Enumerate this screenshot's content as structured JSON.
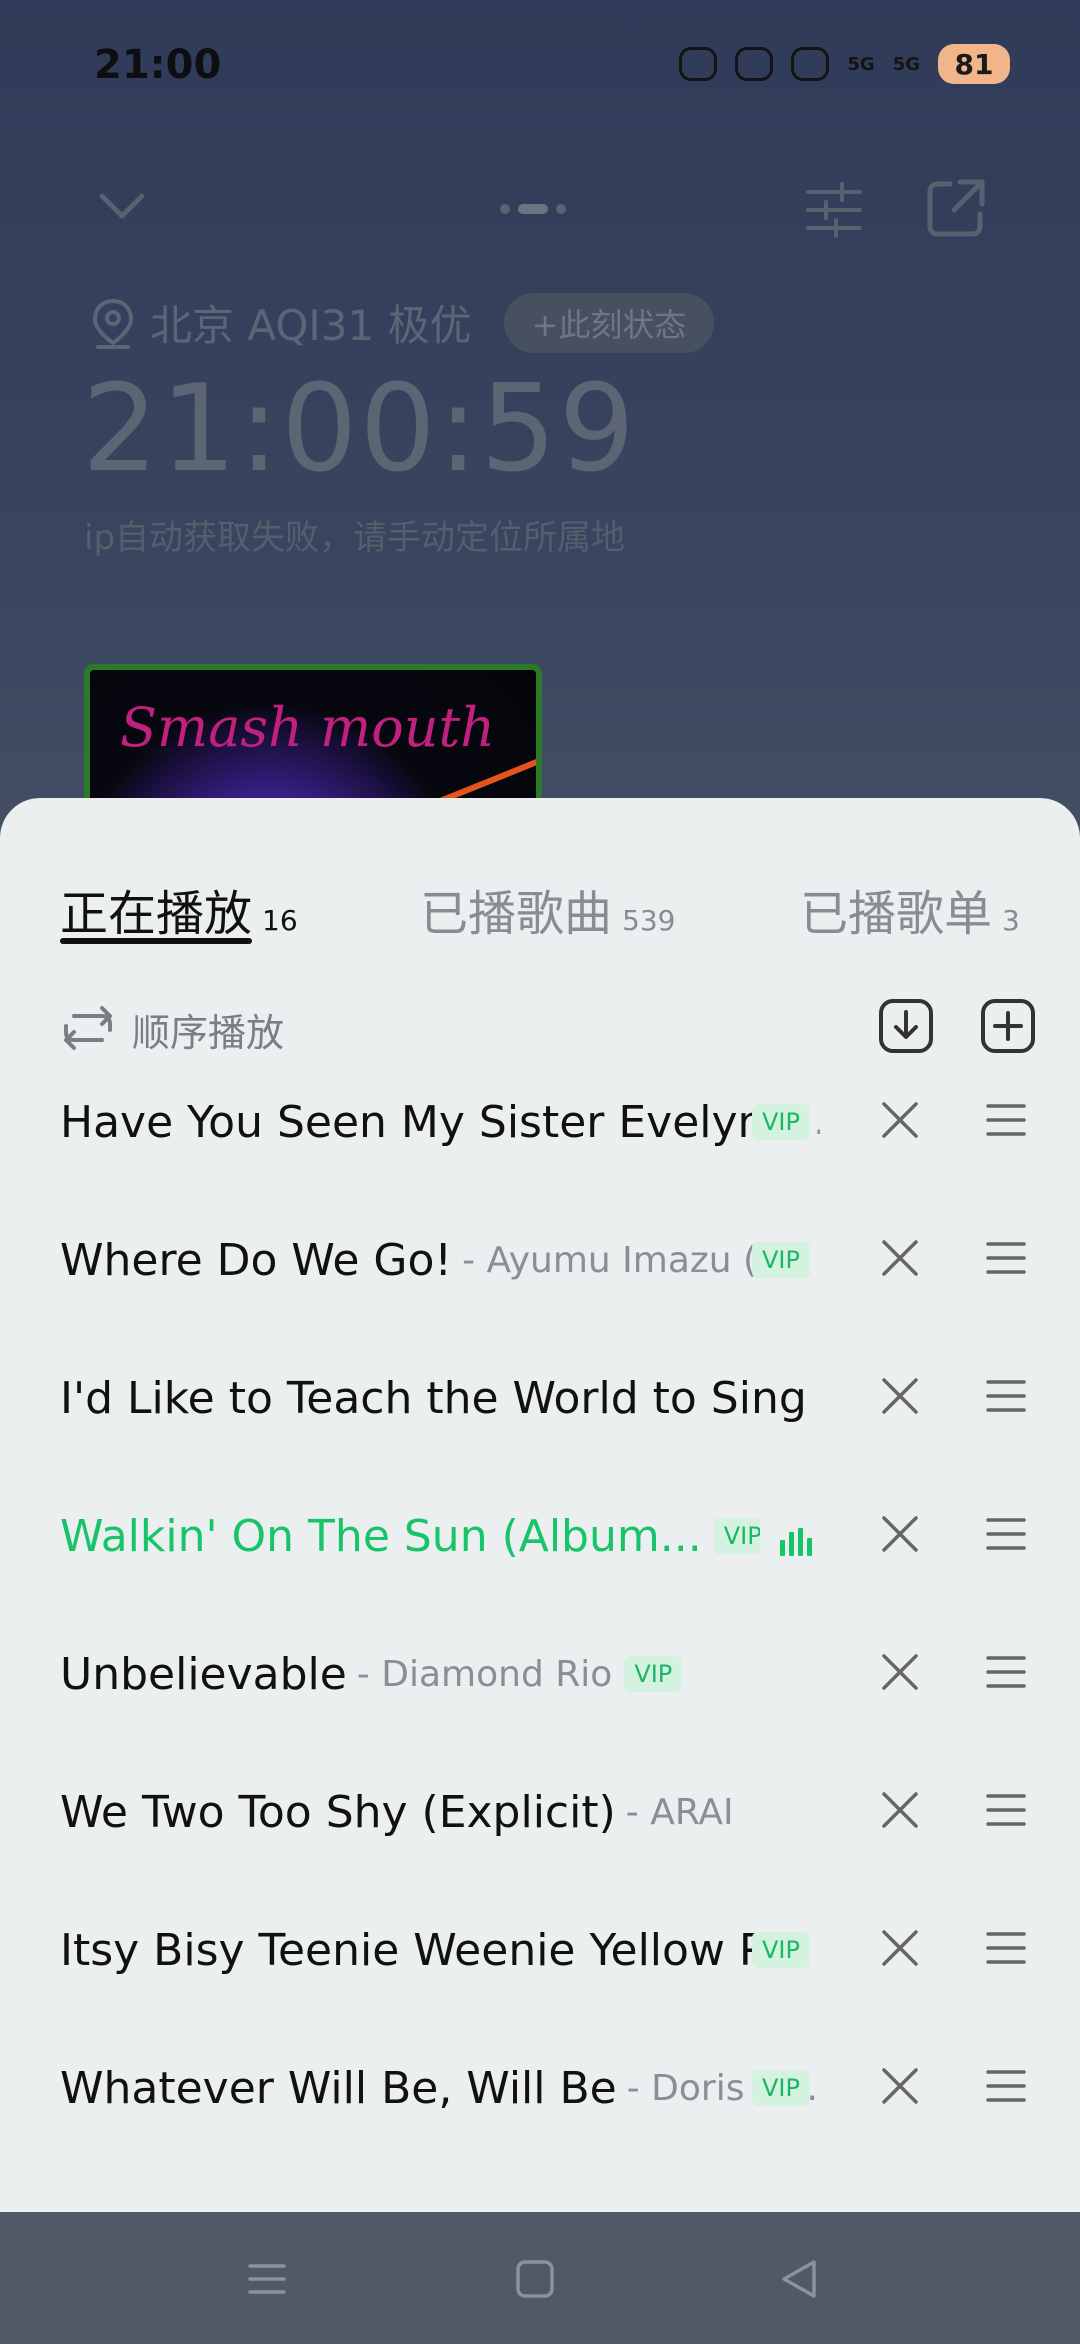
{
  "status_bar": {
    "time": "21:00",
    "network_1": "5G",
    "network_2": "5G",
    "battery": "81"
  },
  "header": {
    "page_dots": 3,
    "active_dot": 1
  },
  "info": {
    "location": "北京 AQI31 极优",
    "status_button": "+此刻状态",
    "clock": "21:00:59",
    "ip_note": "ip自动获取失败，请手动定位所属地"
  },
  "album": {
    "art_text": "Smash mouth"
  },
  "sheet": {
    "tabs": [
      {
        "label": "正在播放",
        "count": "16"
      },
      {
        "label": "已播歌曲",
        "count": "539"
      },
      {
        "label": "已播歌单",
        "count": "3"
      }
    ],
    "mode_label": "顺序播放",
    "songs": [
      {
        "name": "Have You Seen My Sister Evelyn?",
        "artist": "...",
        "vip": "VIP"
      },
      {
        "name": "Where Do We Go!",
        "artist": "- Ayumu Imazu (...",
        "vip": "VIP"
      },
      {
        "name": "I'd Like to Teach the World to Sing (I...",
        "artist": "",
        "vip": ""
      },
      {
        "name": "Walkin' On The Sun (Album...",
        "artist": "",
        "vip": "VIP"
      },
      {
        "name": "Unbelievable",
        "artist": "- Diamond Rio",
        "vip": "VIP"
      },
      {
        "name": "We Two Too Shy (Explicit)",
        "artist": "- ARAI",
        "vip": ""
      },
      {
        "name": "Itsy Bisy Teenie Weenie Yellow P...",
        "artist": "",
        "vip": "VIP"
      },
      {
        "name": "Whatever Will Be, Will Be",
        "artist": "- Doris D...",
        "vip": "VIP"
      }
    ]
  },
  "colors": {
    "accent": "#18c46a",
    "vip_bg": "#d5f2e1",
    "sheet_bg": "#eceff0"
  },
  "icons": [
    "chevron-down-icon",
    "equalizer-icon",
    "share-icon",
    "location-icon",
    "repeat-icon",
    "download-icon",
    "add-icon",
    "close-icon",
    "drag-handle-icon",
    "playing-bars-icon",
    "nav-menu-icon",
    "nav-home-icon",
    "nav-back-icon"
  ]
}
